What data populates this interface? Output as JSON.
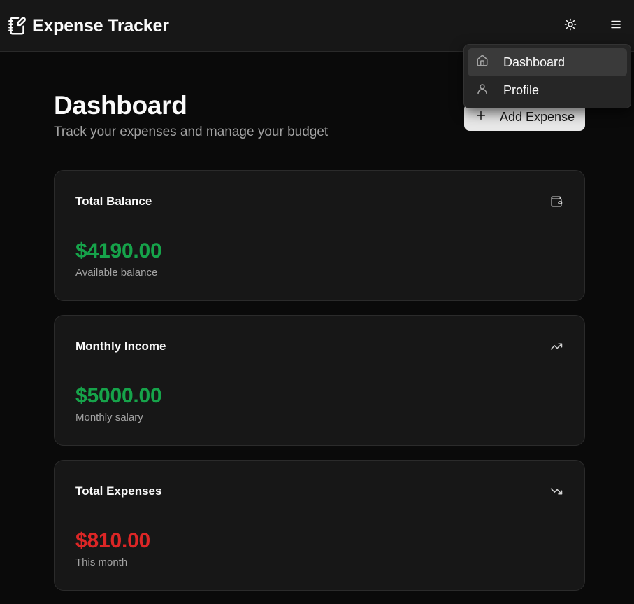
{
  "app": {
    "title": "Expense Tracker",
    "logo_icon": "notebook-pen-icon"
  },
  "header": {
    "theme_toggle_icon": "sun-icon",
    "menu_icon": "hamburger-menu-icon"
  },
  "dropdown": {
    "items": [
      {
        "label": "Dashboard",
        "icon": "home-icon",
        "active": true
      },
      {
        "label": "Profile",
        "icon": "user-icon",
        "active": false
      }
    ]
  },
  "page": {
    "title": "Dashboard",
    "subtitle": "Track your expenses and manage your budget",
    "add_button_label": "Add Expense",
    "add_button_icon": "plus-icon"
  },
  "cards": [
    {
      "title": "Total Balance",
      "amount": "$4190.00",
      "caption": "Available balance",
      "icon": "wallet-icon",
      "tone": "positive"
    },
    {
      "title": "Monthly Income",
      "amount": "$5000.00",
      "caption": "Monthly salary",
      "icon": "trending-up-icon",
      "tone": "positive"
    },
    {
      "title": "Total Expenses",
      "amount": "$810.00",
      "caption": "This month",
      "icon": "trending-down-icon",
      "tone": "negative"
    }
  ],
  "colors": {
    "background": "#0a0a0a",
    "surface": "#171717",
    "positive": "#16a34a",
    "negative": "#dc2626",
    "muted_text": "#a3a3a3"
  }
}
